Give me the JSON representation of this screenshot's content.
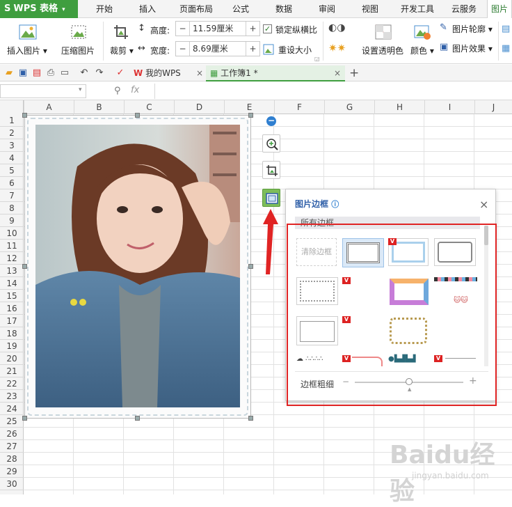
{
  "app": {
    "name": "WPS 表格",
    "logo_letter": "S"
  },
  "ribbon_tabs": [
    {
      "label": "开始",
      "active": false
    },
    {
      "label": "插入",
      "active": false
    },
    {
      "label": "页面布局",
      "active": false
    },
    {
      "label": "公式",
      "active": false
    },
    {
      "label": "数据",
      "active": false
    },
    {
      "label": "审阅",
      "active": false
    },
    {
      "label": "视图",
      "active": false
    },
    {
      "label": "开发工具",
      "active": false
    },
    {
      "label": "云服务",
      "active": false
    },
    {
      "label": "图片",
      "active": true
    }
  ],
  "ribbon": {
    "insert_picture": "插入图片",
    "compress_picture": "压缩图片",
    "crop": "裁剪",
    "height_label": "高度:",
    "height_value": "11.59厘米",
    "width_label": "宽度:",
    "width_value": "8.69厘米",
    "lock_ratio": "锁定纵横比",
    "lock_ratio_checked": true,
    "reset_size": "重设大小",
    "set_transparent": "设置透明色",
    "color": "颜色",
    "picture_outline": "图片轮廓",
    "picture_effect": "图片效果"
  },
  "doc_tabs": [
    {
      "label": "我的WPS",
      "active": false
    },
    {
      "label": "工作簿1 *",
      "active": true
    }
  ],
  "formula_bar": {
    "fx": "fx"
  },
  "columns": [
    "A",
    "B",
    "C",
    "D",
    "E",
    "F",
    "G",
    "H",
    "I",
    "J"
  ],
  "rows": [
    "1",
    "2",
    "3",
    "4",
    "5",
    "6",
    "7",
    "8",
    "9",
    "10",
    "11",
    "12",
    "13",
    "14",
    "15",
    "16",
    "17",
    "18",
    "19",
    "20",
    "21",
    "22",
    "23",
    "24",
    "25",
    "26",
    "27",
    "28",
    "29",
    "30"
  ],
  "popup": {
    "title": "图片边框",
    "category": "所有边框",
    "clear_border": "清除边框",
    "thickness_label": "边框粗细",
    "slider_value": 0.5,
    "vip_badge": "V"
  },
  "watermark": {
    "main": "Baidu经验",
    "sub": "jingyan.baidu.com"
  },
  "colors": {
    "accent_green": "#3f9e3f",
    "highlight_red": "#e02424",
    "title_blue": "#2f5fa8"
  }
}
